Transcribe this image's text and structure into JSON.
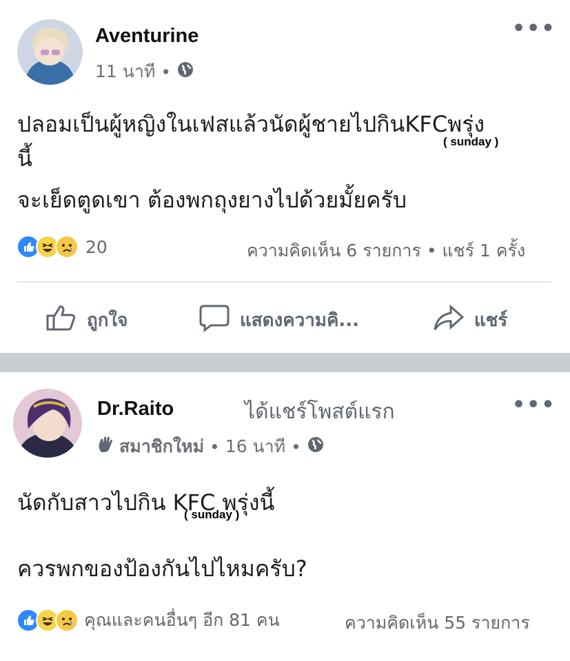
{
  "post1": {
    "author": "Aventurine",
    "time": "11 นาที",
    "separator": "•",
    "line1": "ปลอมเป็นผู้หญิงในเฟสแล้วนัดผู้ชายไปกินKFCพรุ่ง",
    "line2": "นี้",
    "annotation": "( sunday )",
    "line3": "จะเย็ดตูดเขา ต้องพกถุงยางไปด้วยมั้ยครับ",
    "reaction_count": "20",
    "stats": "ความคิดเห็น 6 รายการ • แชร์ 1 ครั้ง",
    "actions": {
      "like": "ถูกใจ",
      "comment": "แสดงความคิ...",
      "share": "แชร์"
    }
  },
  "post2": {
    "author": "Dr.Raito",
    "badge_text": "ได้แชร์โพสต์แรก",
    "member_label": "สมาชิกใหม่",
    "time": "16 นาที",
    "separator": "•",
    "line1": "นัดกับสาวไปกิน KFC พรุ่งนี้",
    "annotation": "( sunday )",
    "line2": "ควรพกของป้องกันไปไหมครับ?",
    "reaction_text": "คุณและคนอื่นๆ อีก 81 คน",
    "comments": "ความคิดเห็น 55 รายการ"
  },
  "icons": {
    "more": "more-dots-icon",
    "globe": "globe-icon",
    "like": "thumbs-up-icon",
    "comment": "comment-bubble-icon",
    "share": "share-arrow-icon",
    "wave": "wave-hand-icon"
  },
  "colors": {
    "like_blue": "#2d88ff",
    "haha_yellow": "#f7d24a",
    "divider": "#c9ccd1",
    "meta_gray": "#65676b"
  }
}
